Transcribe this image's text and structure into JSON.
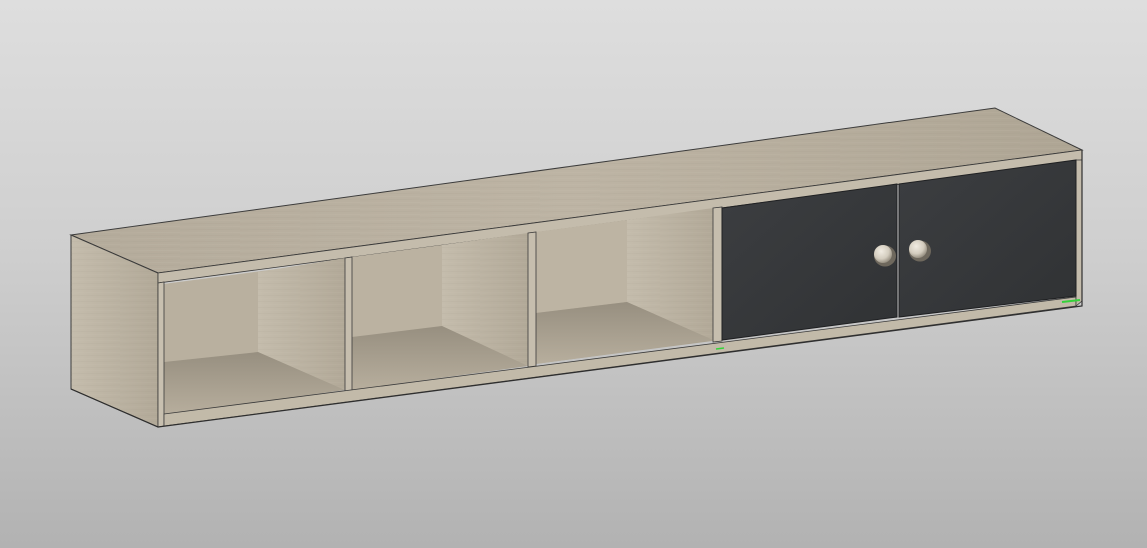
{
  "viewport": {
    "background_top": "#dedede",
    "background_bottom": "#b2b2b2"
  },
  "model": {
    "object": "wall-mounted-media-cabinet",
    "material_wood_color": "#b9b0a0",
    "material_wood_dark": "#8e8677",
    "door_color": "#37393c",
    "knob_color": "#d6d0c3",
    "edge_line_color": "#3a3a3a",
    "selection_highlight_color": "#34d23a",
    "open_compartments": 3,
    "doors": 2,
    "knobs": 2
  }
}
